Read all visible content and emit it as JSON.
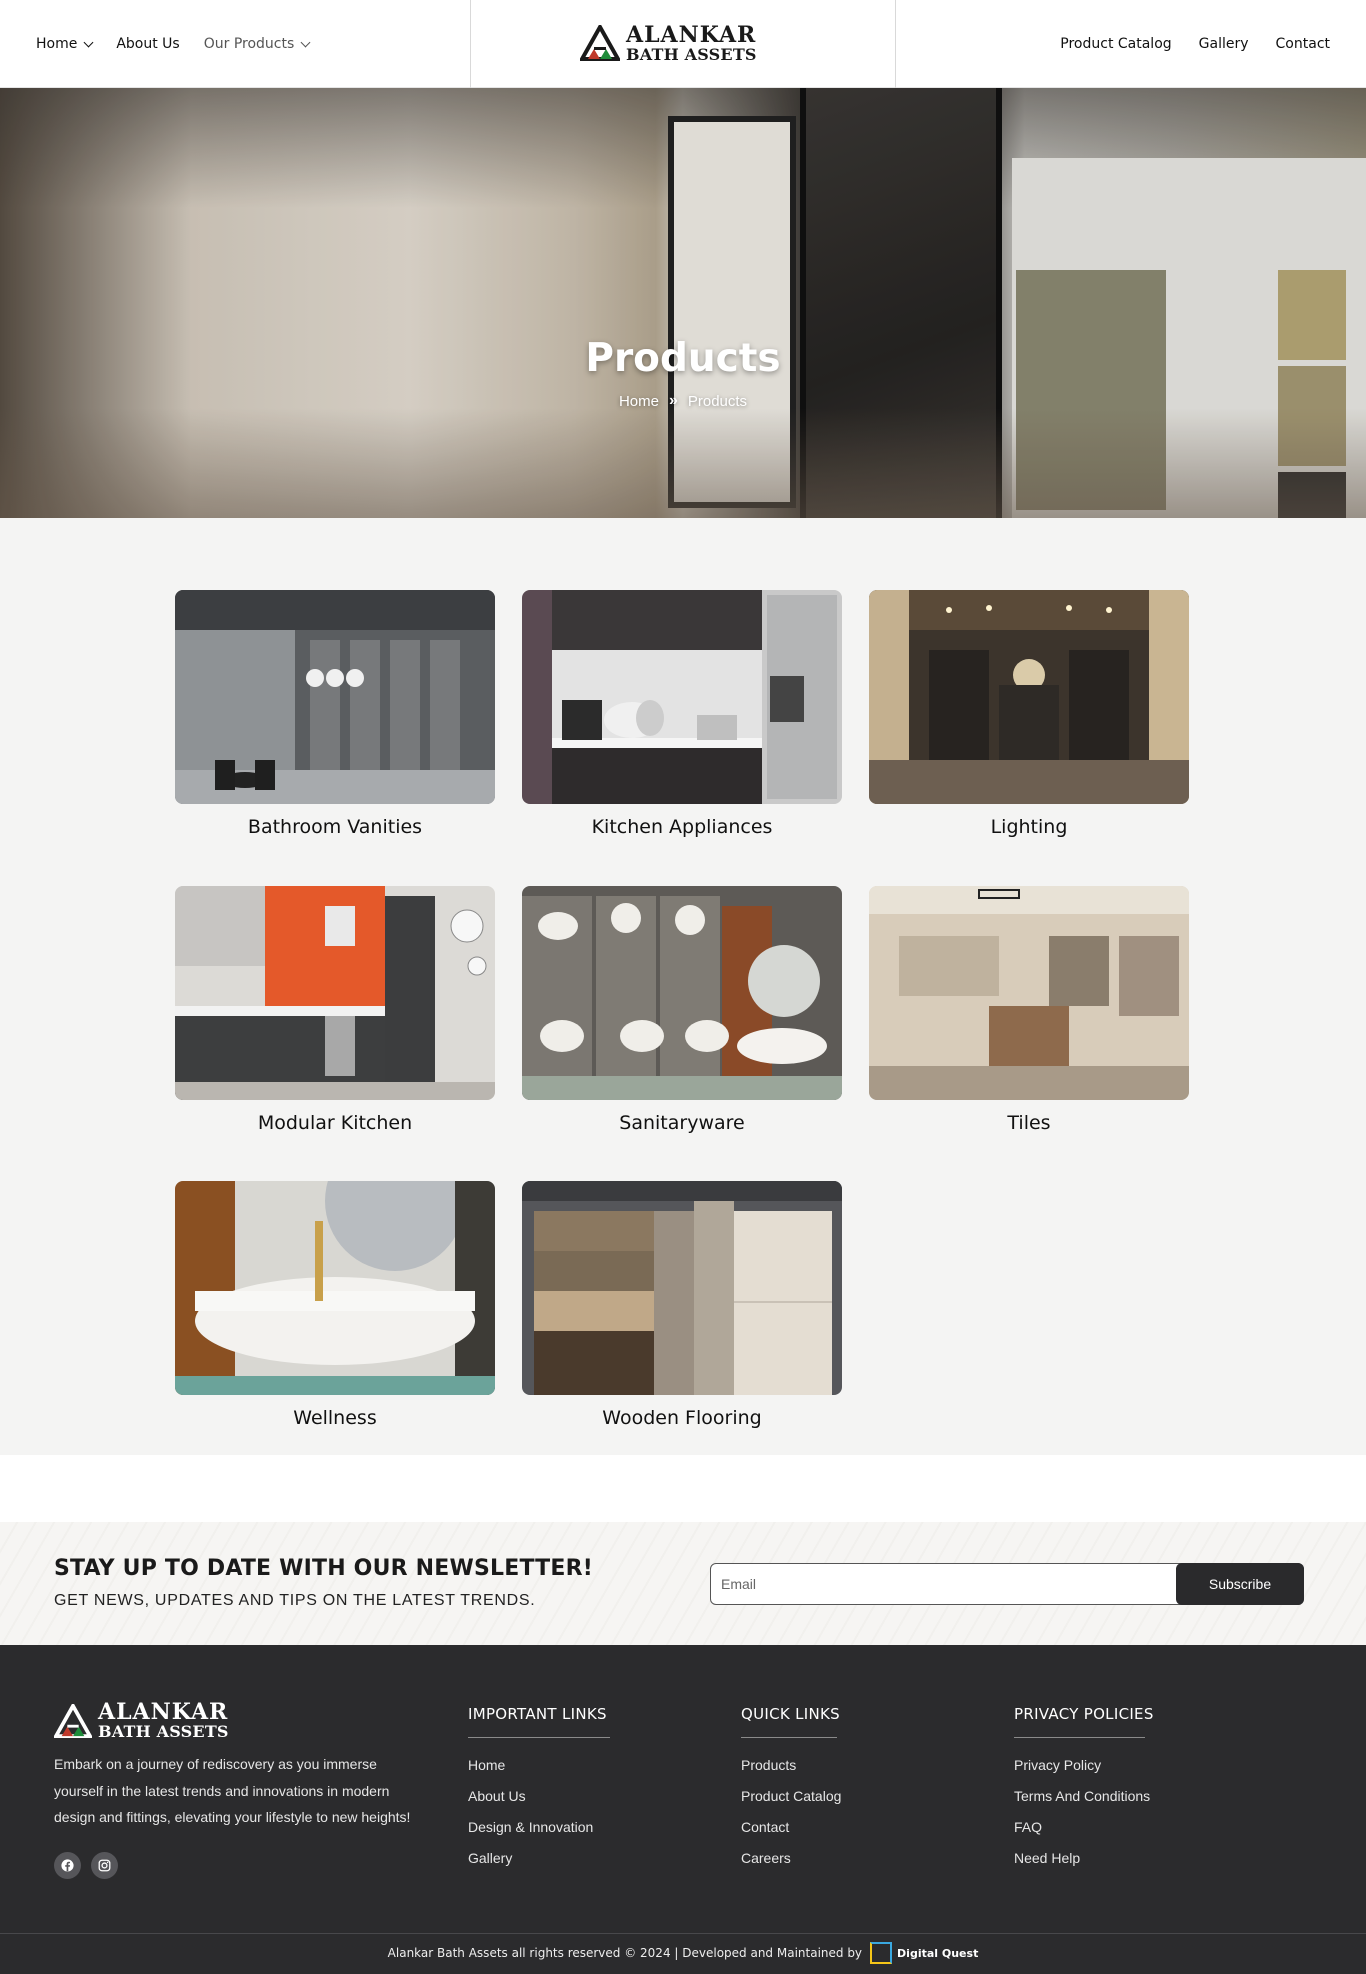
{
  "header": {
    "nav_left": [
      {
        "label": "Home",
        "has_dropdown": true,
        "active": true
      },
      {
        "label": "About Us",
        "has_dropdown": false,
        "active": false
      },
      {
        "label": "Our Products",
        "has_dropdown": true,
        "active": false
      }
    ],
    "logo": {
      "line1": "ALANKAR",
      "line2": "BATH ASSETS",
      "mark": "AB",
      "icon": "alankar-logo-icon"
    },
    "nav_right": [
      {
        "label": "Product Catalog"
      },
      {
        "label": "Gallery"
      },
      {
        "label": "Contact"
      }
    ]
  },
  "hero": {
    "title": "Products",
    "breadcrumb": {
      "home": "Home",
      "separator": "»",
      "current": "Products"
    }
  },
  "products": [
    {
      "title": "Bathroom Vanities",
      "image": "bathroom-vanities-image"
    },
    {
      "title": "Kitchen Appliances",
      "image": "kitchen-appliances-image"
    },
    {
      "title": "Lighting",
      "image": "lighting-image"
    },
    {
      "title": "Modular Kitchen",
      "image": "modular-kitchen-image"
    },
    {
      "title": "Sanitaryware",
      "image": "sanitaryware-image"
    },
    {
      "title": "Tiles",
      "image": "tiles-image"
    },
    {
      "title": "Wellness",
      "image": "wellness-image"
    },
    {
      "title": "Wooden Flooring",
      "image": "wooden-flooring-image"
    }
  ],
  "newsletter": {
    "title": "STAY UP TO DATE WITH OUR NEWSLETTER!",
    "subtitle": "GET NEWS, UPDATES AND TIPS ON THE LATEST TRENDS.",
    "email_placeholder": "Email",
    "email_value": "",
    "button_label": "Subscribe"
  },
  "footer": {
    "logo": {
      "line1": "ALANKAR",
      "line2": "BATH ASSETS",
      "mark": "AB"
    },
    "description": "Embark on a journey of rediscovery as you immerse yourself in the latest trends and innovations in modern design and fittings, elevating your lifestyle to new heights!",
    "social": [
      {
        "name": "facebook-icon"
      },
      {
        "name": "instagram-icon"
      }
    ],
    "columns": [
      {
        "heading": "IMPORTANT LINKS",
        "links": [
          "Home",
          "About Us",
          "Design & Innovation",
          "Gallery"
        ]
      },
      {
        "heading": "QUICK LINKS",
        "links": [
          "Products",
          "Product Catalog",
          "Contact",
          "Careers"
        ]
      },
      {
        "heading": "PRIVACY POLICIES",
        "links": [
          "Privacy Policy",
          "Terms And Conditions",
          "FAQ",
          "Need Help"
        ]
      }
    ],
    "copyright": "Alankar Bath Assets all rights reserved © 2024 | Developed and Maintained by",
    "developer": "Digital Quest"
  },
  "colors": {
    "accent_dark": "#2a2a2c",
    "footer_bg": "#2b2b2d",
    "logo_red": "#c0392b",
    "logo_green": "#1e8c3a"
  }
}
